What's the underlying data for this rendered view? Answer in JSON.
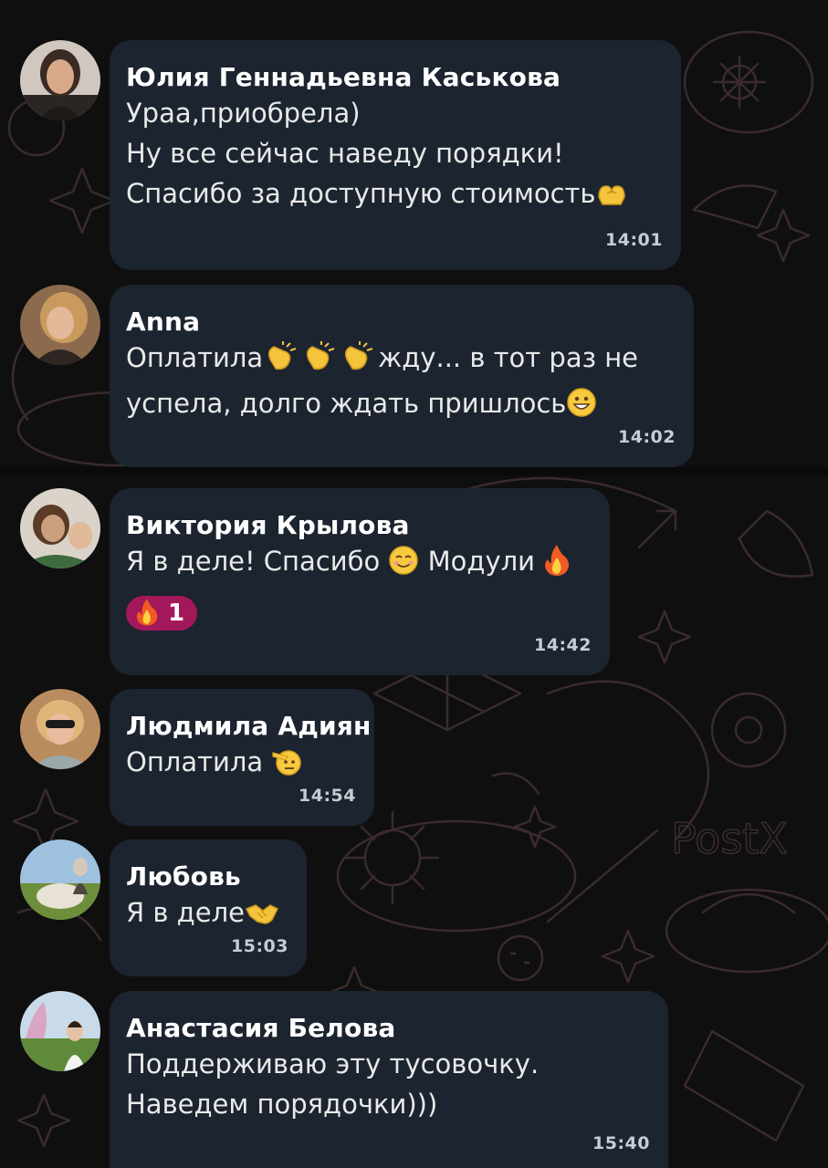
{
  "wallpaper": {
    "brand_mark": "PostX"
  },
  "messages": [
    {
      "sender": "Юлия Геннадьевна Каськова",
      "lines": [
        "Ураа,приобрела)",
        "Ну все сейчас наведу порядки!",
        "Спасибо за доступную стоимость"
      ],
      "emoji": [
        "heart-hands-emoji"
      ],
      "time": "14:01",
      "avatar": "user-avatar-photo"
    },
    {
      "sender": "Anna",
      "lines": [
        "Оплатила",
        "жду... в тот раз не",
        "успела, долго ждать пришлось"
      ],
      "emoji": [
        "clapping-hands-emoji",
        "clapping-hands-emoji",
        "clapping-hands-emoji",
        "grinning-face-emoji"
      ],
      "time": "14:02",
      "avatar": "user-avatar-photo"
    },
    {
      "sender": "Виктория Крылова",
      "lines": [
        "Я в деле! Спасибо",
        "Модули"
      ],
      "emoji": [
        "smiling-face-emoji",
        "fire-emoji"
      ],
      "reaction": {
        "emoji": "fire-emoji",
        "count": "1",
        "color": "#a3185b"
      },
      "time": "14:42",
      "avatar": "user-avatar-photo"
    },
    {
      "sender": "Людмила Адиян",
      "lines": [
        "Оплатила"
      ],
      "emoji": [
        "saluting-face-emoji"
      ],
      "time": "14:54",
      "avatar": "user-avatar-photo"
    },
    {
      "sender": "Любовь",
      "lines": [
        "Я в деле"
      ],
      "emoji": [
        "handshake-emoji"
      ],
      "time": "15:03",
      "avatar": "user-avatar-photo"
    },
    {
      "sender": "Анастасия Белова",
      "lines": [
        "Поддерживаю эту тусовочку.",
        "Наведем порядочки)))"
      ],
      "emoji": [],
      "time": "15:40",
      "avatar": "user-avatar-photo"
    }
  ],
  "colors": {
    "background": "#0f0f0f",
    "bubble": "#1c2430",
    "reaction": "#a3185b",
    "wallpaper_stroke": "#3a2a2e"
  }
}
